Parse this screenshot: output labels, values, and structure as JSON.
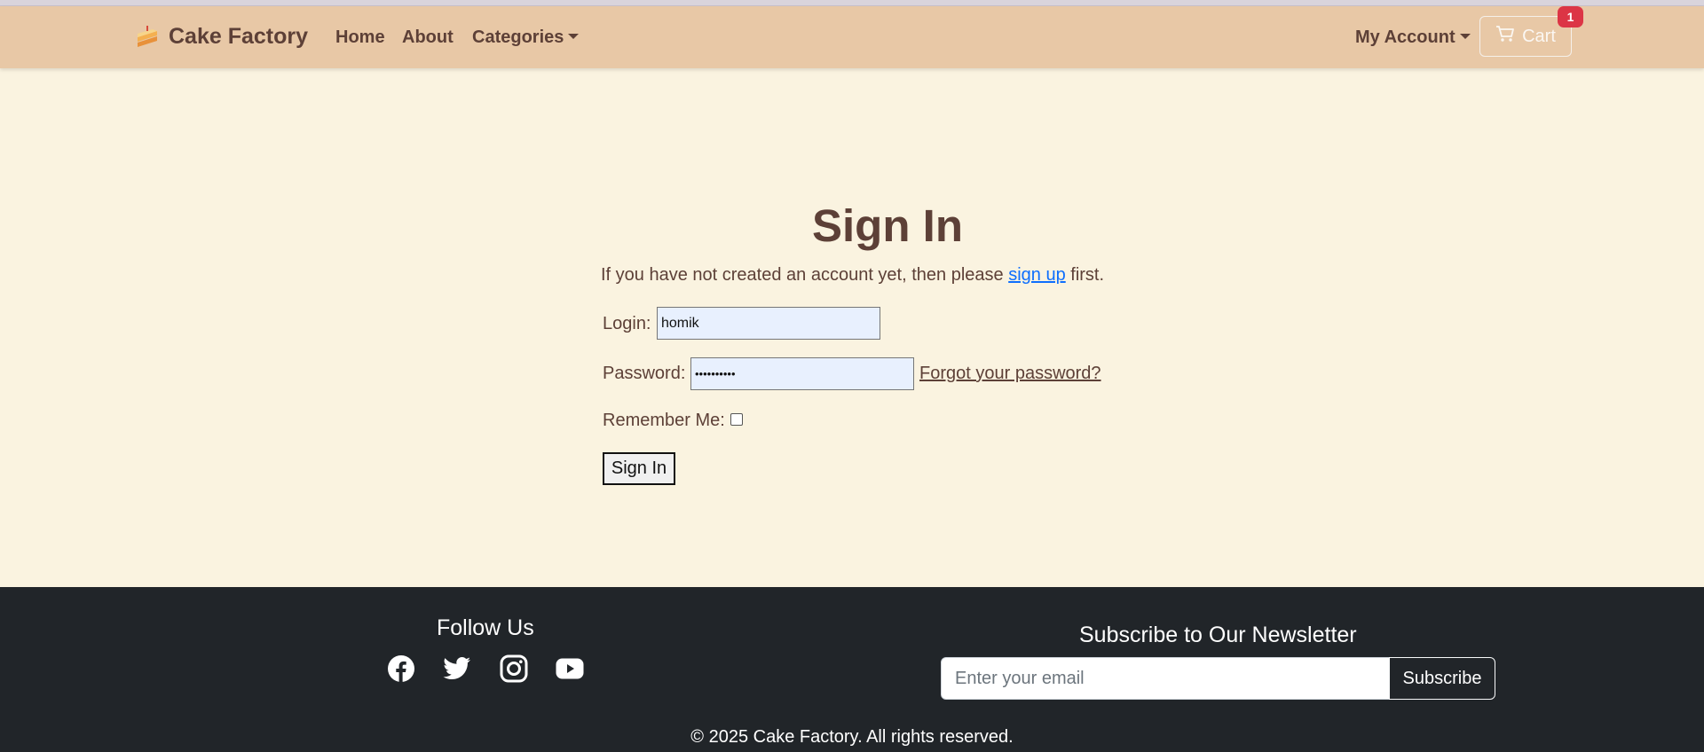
{
  "navbar": {
    "brand": "Cake Factory",
    "brand_icon": "cake-slice-icon",
    "links": {
      "home": "Home",
      "about": "About",
      "categories": "Categories"
    },
    "my_account": "My Account",
    "cart_label": "Cart",
    "cart_icon": "cart-icon",
    "cart_count": "1"
  },
  "signin": {
    "title": "Sign In",
    "intro_before": "If you have not created an account yet, then please ",
    "signup_link": "sign up",
    "intro_after": " first.",
    "login_label": "Login:",
    "login_value": "homik",
    "password_label": "Password:",
    "password_value": "••••••••••",
    "forgot_link": "Forgot your password?",
    "remember_label": "Remember Me:",
    "remember_checked": false,
    "submit_label": "Sign In"
  },
  "footer": {
    "follow_title": "Follow Us",
    "social_icons": [
      "facebook-icon",
      "twitter-icon",
      "instagram-icon",
      "youtube-icon"
    ],
    "newsletter_title": "Subscribe to Our Newsletter",
    "email_placeholder": "Enter your email",
    "subscribe_label": "Subscribe",
    "copyright": "© 2025 Cake Factory. All rights reserved."
  },
  "colors": {
    "navbar_bg": "#e8c8a6",
    "page_bg": "#faf3e0",
    "text_brown": "#5d4037",
    "link_blue": "#0d6efd",
    "badge_red": "#dc3545",
    "footer_bg": "#212529"
  }
}
